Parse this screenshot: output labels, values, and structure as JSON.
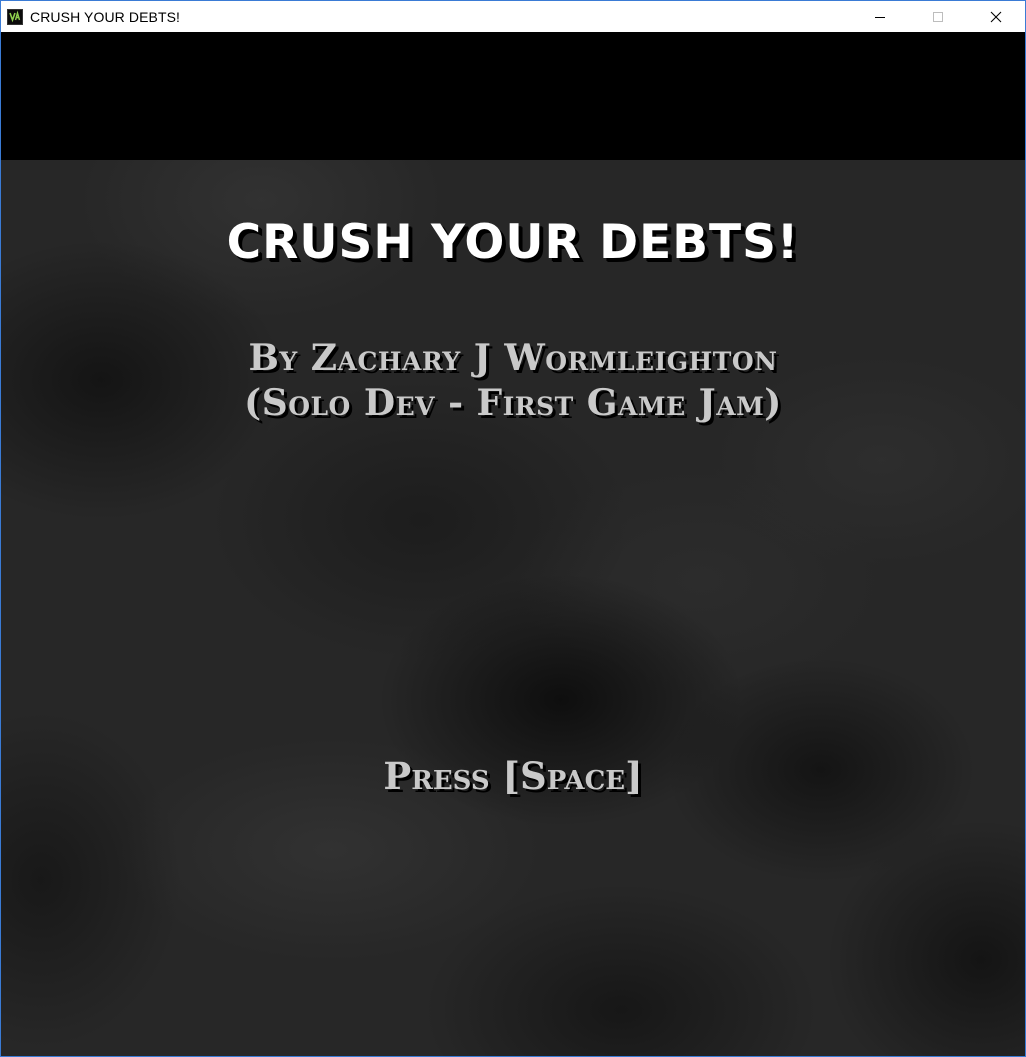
{
  "window": {
    "title": "CRUSH YOUR DEBTS!",
    "icon": "app-icon",
    "controls": [
      "minimize-icon",
      "maximize-icon",
      "close-icon"
    ]
  },
  "screen": {
    "title": "CRUSH YOUR DEBTS!",
    "credit_line1": "By Zachary J Wormleighton",
    "credit_line2": "(Solo Dev - First Game Jam)",
    "prompt": "Press [Space]"
  },
  "colors": {
    "title_text": "#ffffff",
    "body_text": "#c9c9c9",
    "background": "#272727",
    "shadow": "#000000"
  }
}
